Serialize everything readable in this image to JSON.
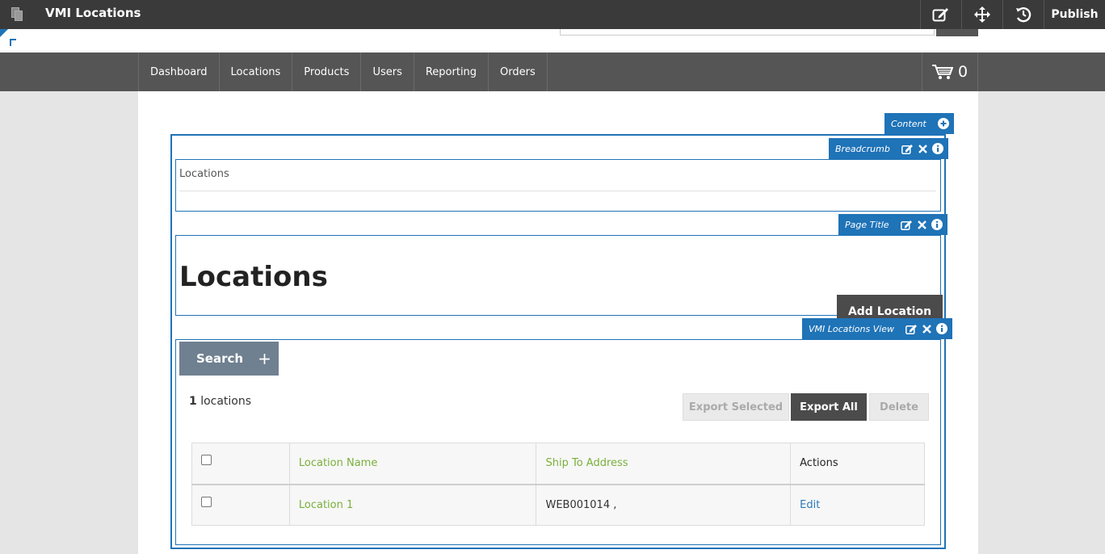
{
  "cms": {
    "title": "VMI Locations",
    "publish_label": "Publish",
    "tools": [
      "edit-icon",
      "move-icon",
      "history-icon"
    ]
  },
  "nav": {
    "items": [
      "Dashboard",
      "Locations",
      "Products",
      "Users",
      "Reporting",
      "Orders"
    ],
    "cart_count": "0"
  },
  "zones": {
    "content_label": "Content",
    "breadcrumb_label": "Breadcrumb",
    "page_title_label": "Page Title",
    "vmi_view_label": "VMI Locations View"
  },
  "breadcrumb": {
    "text": "Locations"
  },
  "page": {
    "title": "Locations",
    "add_location_label": "Add Location"
  },
  "vmi": {
    "search_label": "Search",
    "count_number": "1",
    "count_suffix": " locations",
    "export_selected_label": "Export Selected",
    "export_all_label": "Export All",
    "delete_label": "Delete"
  },
  "table": {
    "columns": [
      "Location Name",
      "Ship To Address",
      "Actions"
    ],
    "rows": [
      {
        "name": "Location 1",
        "address": "WEB001014 ,",
        "action": "Edit"
      }
    ]
  },
  "colors": {
    "cms_bar": "#3a3a3a",
    "nav": "#555555",
    "zone_accent": "#1f73b7",
    "link_green": "#7ab03a",
    "link_blue": "#2a7ab8"
  }
}
